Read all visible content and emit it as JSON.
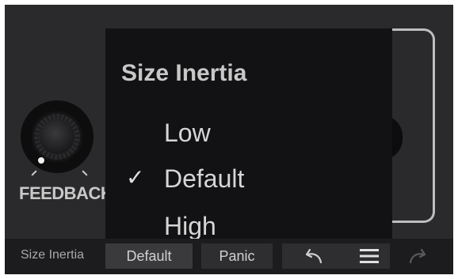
{
  "knob": {
    "label": "FEEDBACK"
  },
  "popup": {
    "title": "Size Inertia",
    "options": [
      {
        "label": "Low",
        "checked": false
      },
      {
        "label": "Default",
        "checked": true
      },
      {
        "label": "High",
        "checked": false
      }
    ],
    "check_glyph": "✓"
  },
  "toolbar": {
    "parameter_label": "Size Inertia",
    "value_button": "Default",
    "panic_button": "Panic",
    "icons": [
      "undo-icon",
      "hamburger-menu-icon",
      "redo-icon"
    ]
  },
  "colors": {
    "panel": "#2a2a2c",
    "menu_bg": "#121214",
    "toolbar": "#1c1c1e",
    "text": "#d6d6d6"
  }
}
